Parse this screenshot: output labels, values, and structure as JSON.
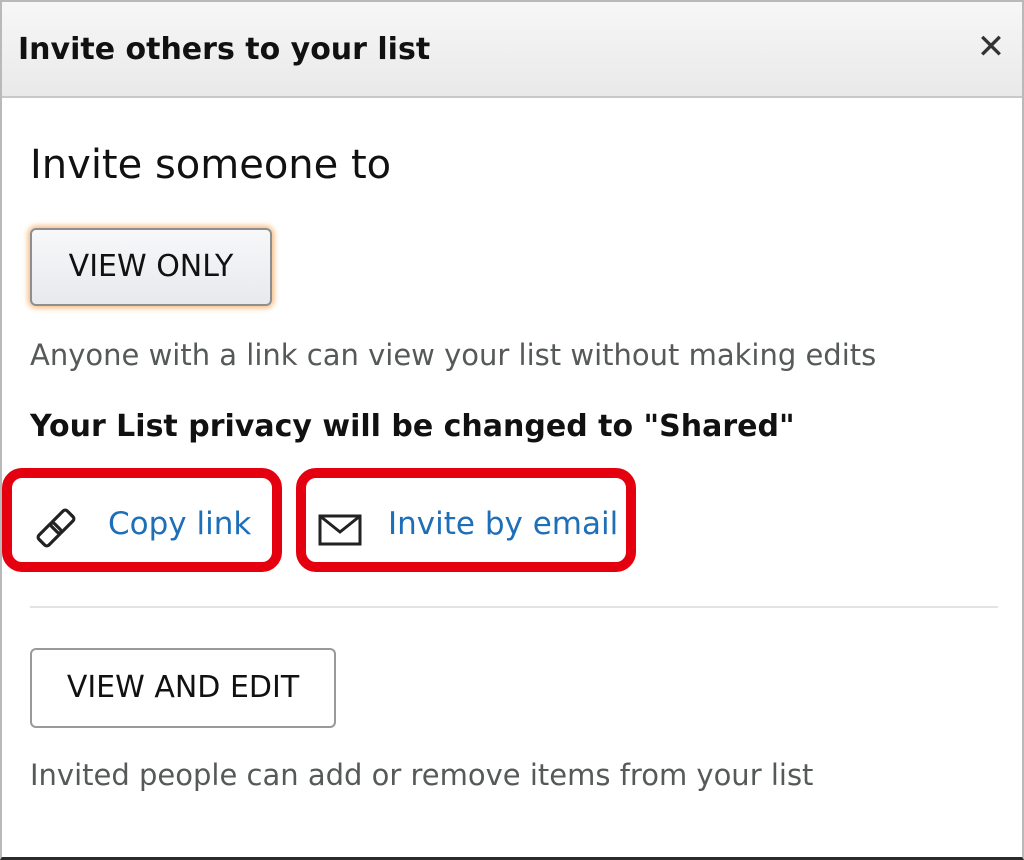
{
  "dialog": {
    "title": "Invite others to your list",
    "close_symbol": "✕"
  },
  "invite": {
    "heading": "Invite someone to",
    "view_only_label": "VIEW ONLY",
    "view_only_description": "Anyone with a link can view your list without making edits",
    "privacy_note": "Your List privacy will be changed to \"Shared\"",
    "actions": {
      "copy_link": {
        "label": "Copy link",
        "icon": "link-icon"
      },
      "invite_email": {
        "label": "Invite by email",
        "icon": "envelope-icon"
      }
    },
    "view_edit_label": "VIEW AND EDIT",
    "view_edit_description": "Invited people can add or remove items from your list"
  },
  "colors": {
    "link_text": "#1e6fb8",
    "highlight_border": "#e5000f",
    "focus_glow": "#f5b87a"
  }
}
